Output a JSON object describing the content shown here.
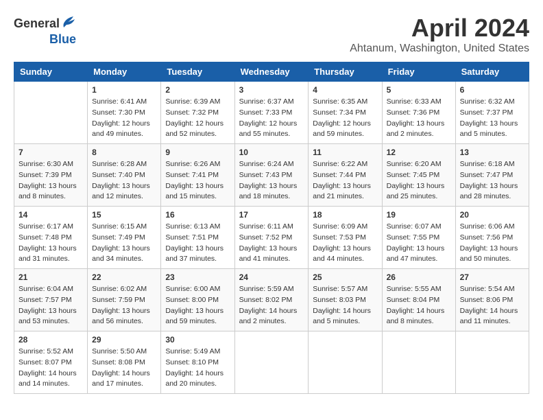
{
  "header": {
    "logo_general": "General",
    "logo_blue": "Blue",
    "title": "April 2024",
    "location": "Ahtanum, Washington, United States"
  },
  "weekdays": [
    "Sunday",
    "Monday",
    "Tuesday",
    "Wednesday",
    "Thursday",
    "Friday",
    "Saturday"
  ],
  "weeks": [
    [
      {
        "day": "",
        "sunrise": "",
        "sunset": "",
        "daylight": ""
      },
      {
        "day": "1",
        "sunrise": "Sunrise: 6:41 AM",
        "sunset": "Sunset: 7:30 PM",
        "daylight": "Daylight: 12 hours and 49 minutes."
      },
      {
        "day": "2",
        "sunrise": "Sunrise: 6:39 AM",
        "sunset": "Sunset: 7:32 PM",
        "daylight": "Daylight: 12 hours and 52 minutes."
      },
      {
        "day": "3",
        "sunrise": "Sunrise: 6:37 AM",
        "sunset": "Sunset: 7:33 PM",
        "daylight": "Daylight: 12 hours and 55 minutes."
      },
      {
        "day": "4",
        "sunrise": "Sunrise: 6:35 AM",
        "sunset": "Sunset: 7:34 PM",
        "daylight": "Daylight: 12 hours and 59 minutes."
      },
      {
        "day": "5",
        "sunrise": "Sunrise: 6:33 AM",
        "sunset": "Sunset: 7:36 PM",
        "daylight": "Daylight: 13 hours and 2 minutes."
      },
      {
        "day": "6",
        "sunrise": "Sunrise: 6:32 AM",
        "sunset": "Sunset: 7:37 PM",
        "daylight": "Daylight: 13 hours and 5 minutes."
      }
    ],
    [
      {
        "day": "7",
        "sunrise": "Sunrise: 6:30 AM",
        "sunset": "Sunset: 7:39 PM",
        "daylight": "Daylight: 13 hours and 8 minutes."
      },
      {
        "day": "8",
        "sunrise": "Sunrise: 6:28 AM",
        "sunset": "Sunset: 7:40 PM",
        "daylight": "Daylight: 13 hours and 12 minutes."
      },
      {
        "day": "9",
        "sunrise": "Sunrise: 6:26 AM",
        "sunset": "Sunset: 7:41 PM",
        "daylight": "Daylight: 13 hours and 15 minutes."
      },
      {
        "day": "10",
        "sunrise": "Sunrise: 6:24 AM",
        "sunset": "Sunset: 7:43 PM",
        "daylight": "Daylight: 13 hours and 18 minutes."
      },
      {
        "day": "11",
        "sunrise": "Sunrise: 6:22 AM",
        "sunset": "Sunset: 7:44 PM",
        "daylight": "Daylight: 13 hours and 21 minutes."
      },
      {
        "day": "12",
        "sunrise": "Sunrise: 6:20 AM",
        "sunset": "Sunset: 7:45 PM",
        "daylight": "Daylight: 13 hours and 25 minutes."
      },
      {
        "day": "13",
        "sunrise": "Sunrise: 6:18 AM",
        "sunset": "Sunset: 7:47 PM",
        "daylight": "Daylight: 13 hours and 28 minutes."
      }
    ],
    [
      {
        "day": "14",
        "sunrise": "Sunrise: 6:17 AM",
        "sunset": "Sunset: 7:48 PM",
        "daylight": "Daylight: 13 hours and 31 minutes."
      },
      {
        "day": "15",
        "sunrise": "Sunrise: 6:15 AM",
        "sunset": "Sunset: 7:49 PM",
        "daylight": "Daylight: 13 hours and 34 minutes."
      },
      {
        "day": "16",
        "sunrise": "Sunrise: 6:13 AM",
        "sunset": "Sunset: 7:51 PM",
        "daylight": "Daylight: 13 hours and 37 minutes."
      },
      {
        "day": "17",
        "sunrise": "Sunrise: 6:11 AM",
        "sunset": "Sunset: 7:52 PM",
        "daylight": "Daylight: 13 hours and 41 minutes."
      },
      {
        "day": "18",
        "sunrise": "Sunrise: 6:09 AM",
        "sunset": "Sunset: 7:53 PM",
        "daylight": "Daylight: 13 hours and 44 minutes."
      },
      {
        "day": "19",
        "sunrise": "Sunrise: 6:07 AM",
        "sunset": "Sunset: 7:55 PM",
        "daylight": "Daylight: 13 hours and 47 minutes."
      },
      {
        "day": "20",
        "sunrise": "Sunrise: 6:06 AM",
        "sunset": "Sunset: 7:56 PM",
        "daylight": "Daylight: 13 hours and 50 minutes."
      }
    ],
    [
      {
        "day": "21",
        "sunrise": "Sunrise: 6:04 AM",
        "sunset": "Sunset: 7:57 PM",
        "daylight": "Daylight: 13 hours and 53 minutes."
      },
      {
        "day": "22",
        "sunrise": "Sunrise: 6:02 AM",
        "sunset": "Sunset: 7:59 PM",
        "daylight": "Daylight: 13 hours and 56 minutes."
      },
      {
        "day": "23",
        "sunrise": "Sunrise: 6:00 AM",
        "sunset": "Sunset: 8:00 PM",
        "daylight": "Daylight: 13 hours and 59 minutes."
      },
      {
        "day": "24",
        "sunrise": "Sunrise: 5:59 AM",
        "sunset": "Sunset: 8:02 PM",
        "daylight": "Daylight: 14 hours and 2 minutes."
      },
      {
        "day": "25",
        "sunrise": "Sunrise: 5:57 AM",
        "sunset": "Sunset: 8:03 PM",
        "daylight": "Daylight: 14 hours and 5 minutes."
      },
      {
        "day": "26",
        "sunrise": "Sunrise: 5:55 AM",
        "sunset": "Sunset: 8:04 PM",
        "daylight": "Daylight: 14 hours and 8 minutes."
      },
      {
        "day": "27",
        "sunrise": "Sunrise: 5:54 AM",
        "sunset": "Sunset: 8:06 PM",
        "daylight": "Daylight: 14 hours and 11 minutes."
      }
    ],
    [
      {
        "day": "28",
        "sunrise": "Sunrise: 5:52 AM",
        "sunset": "Sunset: 8:07 PM",
        "daylight": "Daylight: 14 hours and 14 minutes."
      },
      {
        "day": "29",
        "sunrise": "Sunrise: 5:50 AM",
        "sunset": "Sunset: 8:08 PM",
        "daylight": "Daylight: 14 hours and 17 minutes."
      },
      {
        "day": "30",
        "sunrise": "Sunrise: 5:49 AM",
        "sunset": "Sunset: 8:10 PM",
        "daylight": "Daylight: 14 hours and 20 minutes."
      },
      {
        "day": "",
        "sunrise": "",
        "sunset": "",
        "daylight": ""
      },
      {
        "day": "",
        "sunrise": "",
        "sunset": "",
        "daylight": ""
      },
      {
        "day": "",
        "sunrise": "",
        "sunset": "",
        "daylight": ""
      },
      {
        "day": "",
        "sunrise": "",
        "sunset": "",
        "daylight": ""
      }
    ]
  ]
}
